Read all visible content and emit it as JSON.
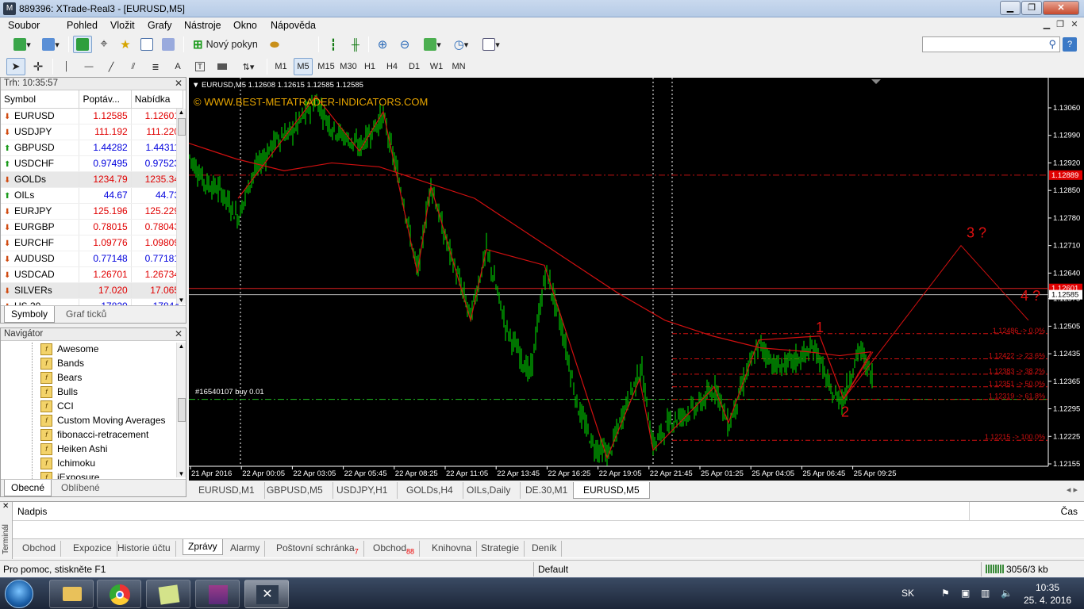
{
  "window": {
    "title": "889396: XTrade-Real3 - [EURUSD,M5]"
  },
  "menu": [
    "Soubor",
    "Pohled",
    "Vložit",
    "Grafy",
    "Nástroje",
    "Okno",
    "Nápověda"
  ],
  "toolbar": {
    "new_order_label": "Nový pokyn"
  },
  "timeframes": [
    "M1",
    "M5",
    "M15",
    "M30",
    "H1",
    "H4",
    "D1",
    "W1",
    "MN"
  ],
  "selected_timeframe": "M5",
  "market_watch": {
    "title": "Trh: 10:35:57",
    "columns": [
      "Symbol",
      "Poptáv...",
      "Nabídka"
    ],
    "rows": [
      {
        "symbol": "EURUSD",
        "bid": "1.12585",
        "ask": "1.12601",
        "dir": "down",
        "color": "red"
      },
      {
        "symbol": "USDJPY",
        "bid": "111.192",
        "ask": "111.220",
        "dir": "down",
        "color": "red"
      },
      {
        "symbol": "GBPUSD",
        "bid": "1.44282",
        "ask": "1.44311",
        "dir": "up",
        "color": "blue"
      },
      {
        "symbol": "USDCHF",
        "bid": "0.97495",
        "ask": "0.97523",
        "dir": "up",
        "color": "blue"
      },
      {
        "symbol": "GOLDs",
        "bid": "1234.79",
        "ask": "1235.34",
        "dir": "down",
        "color": "red"
      },
      {
        "symbol": "OILs",
        "bid": "44.67",
        "ask": "44.73",
        "dir": "up",
        "color": "blue"
      },
      {
        "symbol": "EURJPY",
        "bid": "125.196",
        "ask": "125.229",
        "dir": "down",
        "color": "red"
      },
      {
        "symbol": "EURGBP",
        "bid": "0.78015",
        "ask": "0.78043",
        "dir": "down",
        "color": "red"
      },
      {
        "symbol": "EURCHF",
        "bid": "1.09776",
        "ask": "1.09809",
        "dir": "down",
        "color": "red"
      },
      {
        "symbol": "AUDUSD",
        "bid": "0.77148",
        "ask": "0.77181",
        "dir": "down",
        "color": "blue"
      },
      {
        "symbol": "USDCAD",
        "bid": "1.26701",
        "ask": "1.26734",
        "dir": "down",
        "color": "red"
      },
      {
        "symbol": "SILVERs",
        "bid": "17.020",
        "ask": "17.065",
        "dir": "down",
        "color": "red"
      },
      {
        "symbol": "US 30",
        "bid": "17820",
        "ask": "17844",
        "dir": "down",
        "color": "blue"
      }
    ],
    "tabs": [
      "Symboly",
      "Graf ticků"
    ]
  },
  "navigator": {
    "title": "Navigátor",
    "items": [
      "Awesome",
      "Bands",
      "Bears",
      "Bulls",
      "CCI",
      "Custom Moving Averages",
      "fibonacci-retracement",
      "Heiken Ashi",
      "Ichimoku",
      "iExposure"
    ],
    "tabs": [
      "Obecné",
      "Oblíbené"
    ]
  },
  "chart": {
    "header": "EURUSD,M5  1.12608 1.12615 1.12585 1.12585",
    "watermark": "© WWW.BEST-METATRADER-INDICATORS.COM",
    "order_label": "#16540107 buy 0.01",
    "price_axis": [
      "1.13060",
      "1.12990",
      "1.12920",
      "1.12850",
      "1.12780",
      "1.12710",
      "1.12640",
      "1.12575",
      "1.12505",
      "1.12435",
      "1.12365",
      "1.12295",
      "1.12225",
      "1.12155"
    ],
    "time_axis": [
      "21 Apr 2016",
      "22 Apr 00:05",
      "22 Apr 03:05",
      "22 Apr 05:45",
      "22 Apr 08:25",
      "22 Apr 11:05",
      "22 Apr 13:45",
      "22 Apr 16:25",
      "22 Apr 19:05",
      "22 Apr 21:45",
      "25 Apr 01:25",
      "25 Apr 04:05",
      "25 Apr 06:45",
      "25 Apr 09:25"
    ],
    "price_tags": {
      "red_line": "1.12889",
      "ask_line": "1.12601",
      "bid_line": "1.12585"
    },
    "fib_levels": [
      "1.12486 -> 0.0%",
      "1.12422 -> 23.6%",
      "1.12383 -> 38.2%",
      "1.12351 -> 50.0%",
      "1.12319 -> 61.8%",
      "1.12215 -> 100.0%"
    ],
    "wave_labels": [
      "1",
      "2",
      "3 ?",
      "4 ?"
    ],
    "colors": {
      "candles": "#00c000",
      "ma": "#d01010",
      "grid_dash": "#ffffff",
      "fib": "#d01010"
    }
  },
  "chart_tabs": [
    "EURUSD,M1",
    "GBPUSD,M5",
    "USDJPY,H1",
    "GOLDs,H4",
    "OILs,Daily",
    "DE.30,M1",
    "EURUSD,M5"
  ],
  "terminal": {
    "side_label": "Terminál",
    "col_subject": "Nadpis",
    "col_time": "Čas",
    "tabs": [
      {
        "label": "Obchod",
        "badge": ""
      },
      {
        "label": "Expozice",
        "badge": ""
      },
      {
        "label": "Historie účtu",
        "badge": ""
      },
      {
        "label": "Zprávy",
        "badge": ""
      },
      {
        "label": "Alarmy",
        "badge": ""
      },
      {
        "label": "Poštovní schránka",
        "badge": "7"
      },
      {
        "label": "Obchod",
        "badge": "88"
      },
      {
        "label": "Knihovna",
        "badge": ""
      },
      {
        "label": "Strategie",
        "badge": ""
      },
      {
        "label": "Deník",
        "badge": ""
      }
    ]
  },
  "status": {
    "help": "Pro pomoc, stiskněte F1",
    "profile": "Default",
    "traffic": "3056/3 kb"
  },
  "taskbar": {
    "lang": "SK",
    "time": "10:35",
    "date": "25. 4. 2016"
  }
}
